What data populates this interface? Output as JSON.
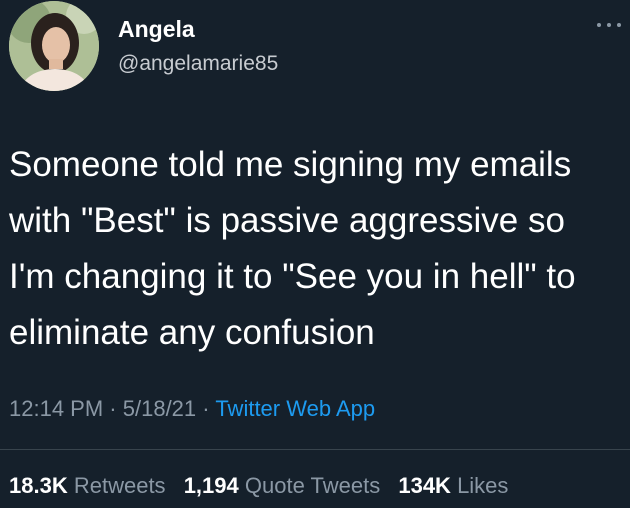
{
  "user": {
    "name": "Angela",
    "handle": "@angelamarie85"
  },
  "tweet": {
    "lines": [
      "Someone told me signing my emails",
      "with \"Best\" is passive aggressive so",
      "I'm changing it to \"See you in hell\" to",
      "eliminate any confusion"
    ]
  },
  "meta": {
    "time": "12:14 PM",
    "date": "5/18/21",
    "separator": "·",
    "source": "Twitter Web App"
  },
  "stats": {
    "retweets_count": "18.3K",
    "retweets_label": "Retweets",
    "quotes_count": "1,194",
    "quotes_label": "Quote Tweets",
    "likes_count": "134K",
    "likes_label": "Likes"
  },
  "icons": {
    "more": "more-horizontal-icon"
  },
  "colors": {
    "background": "#15202b",
    "link": "#1d9bf0",
    "secondary_text": "#8b98a5"
  }
}
